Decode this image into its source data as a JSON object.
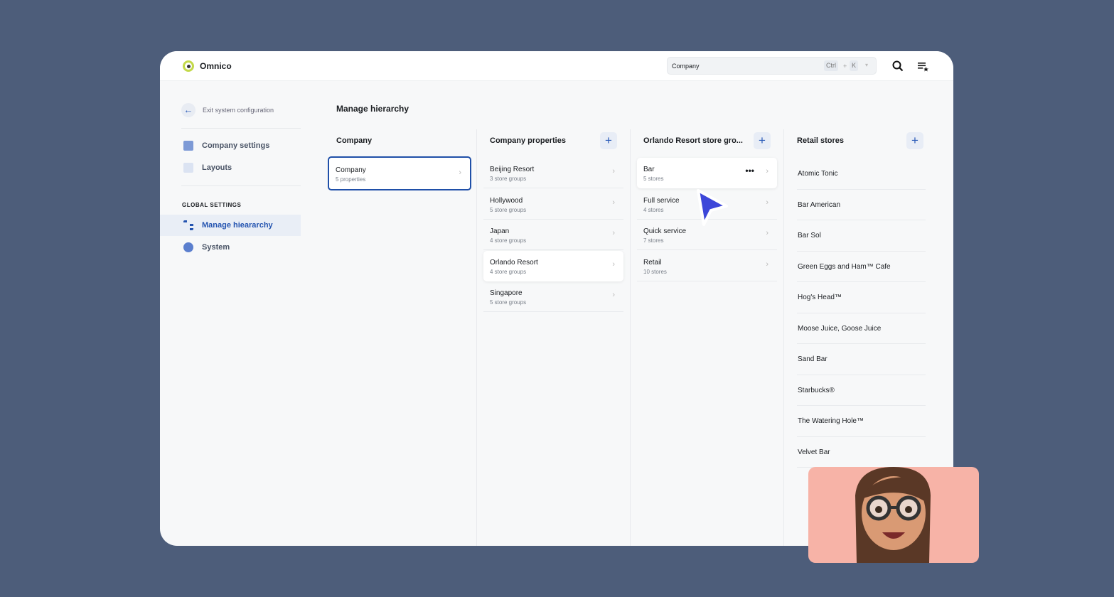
{
  "app": {
    "name": "Omnico"
  },
  "header": {
    "search_value": "Company",
    "kbd_ctrl": "Ctrl",
    "kbd_plus": "+",
    "kbd_k": "K"
  },
  "sidebar": {
    "exit": "Exit system configuration",
    "items": [
      {
        "label": "Company settings"
      },
      {
        "label": "Layouts"
      }
    ],
    "section": "GLOBAL SETTINGS",
    "global": [
      {
        "label": "Manage hieararchy"
      },
      {
        "label": "System"
      }
    ]
  },
  "main": {
    "title": "Manage hierarchy",
    "columns": [
      {
        "title": "Company",
        "items": [
          {
            "name": "Company",
            "sub": "5 properties"
          }
        ]
      },
      {
        "title": "Company properties",
        "items": [
          {
            "name": "Beijing Resort",
            "sub": "3 store groups"
          },
          {
            "name": "Hollywood",
            "sub": "5 store groups"
          },
          {
            "name": "Japan",
            "sub": "4 store groups"
          },
          {
            "name": "Orlando Resort",
            "sub": "4 store groups"
          },
          {
            "name": "Singapore",
            "sub": "5 store groups"
          }
        ]
      },
      {
        "title": "Orlando Resort store gro...",
        "items": [
          {
            "name": "Bar",
            "sub": "5 stores"
          },
          {
            "name": "Full service",
            "sub": "4 stores"
          },
          {
            "name": "Quick service",
            "sub": "7 stores"
          },
          {
            "name": "Retail",
            "sub": "10 stores"
          }
        ]
      },
      {
        "title": "Retail stores",
        "items": [
          "Atomic Tonic",
          "Bar American",
          "Bar Sol",
          "Green Eggs and Ham™ Cafe",
          "Hog's Head™",
          "Moose Juice, Goose Juice",
          "Sand Bar",
          "Starbucks®",
          "The Watering Hole™",
          "Velvet Bar"
        ]
      }
    ]
  },
  "colors": {
    "accent": "#1f4fa8",
    "background": "#4d5d7a",
    "cursor": "#3d47d9"
  }
}
